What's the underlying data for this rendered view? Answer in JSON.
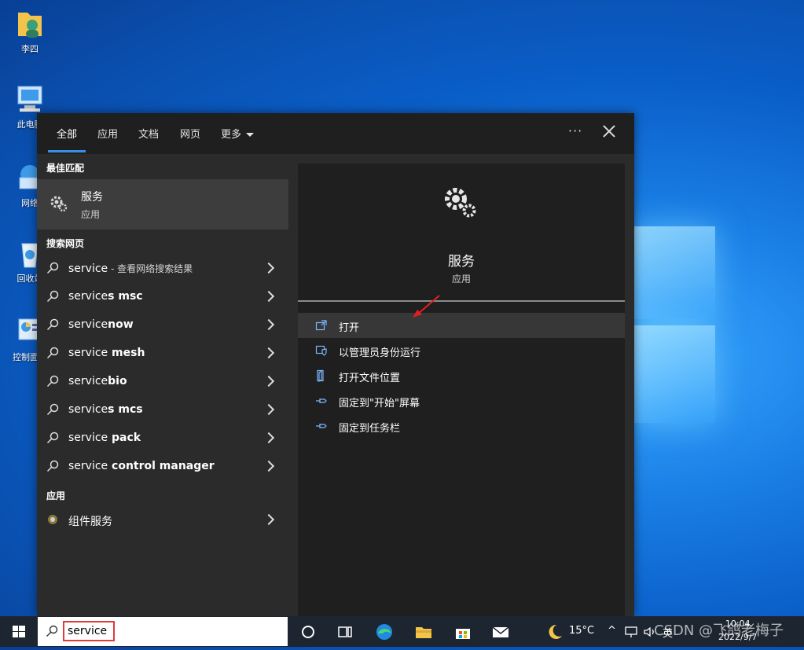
{
  "desktop": {
    "icons": [
      {
        "label": "李四",
        "icon": "user-folder-icon"
      },
      {
        "label": "此电脑",
        "icon": "computer-icon"
      },
      {
        "label": "网络",
        "icon": "network-icon"
      },
      {
        "label": "回收站",
        "icon": "recycle-bin-icon"
      },
      {
        "label": "控制面板",
        "icon": "control-panel-icon"
      }
    ]
  },
  "search_panel": {
    "tabs": [
      "全部",
      "应用",
      "文档",
      "网页",
      "更多"
    ],
    "active_tab": "全部",
    "ellipsis": "···",
    "best_match": {
      "section": "最佳匹配",
      "name": "服务",
      "type": "应用"
    },
    "web": {
      "section": "搜索网页",
      "items": [
        {
          "plain": "service",
          "bold": "",
          "hint": " - 查看网络搜索结果"
        },
        {
          "plain": "service",
          "bold": "s msc",
          "hint": ""
        },
        {
          "plain": "service",
          "bold": "now",
          "hint": ""
        },
        {
          "plain": "service",
          "bold": " mesh",
          "hint": ""
        },
        {
          "plain": "service",
          "bold": "bio",
          "hint": ""
        },
        {
          "plain": "service",
          "bold": "s mcs",
          "hint": ""
        },
        {
          "plain": "service",
          "bold": " pack",
          "hint": ""
        },
        {
          "plain": "service",
          "bold": " control manager",
          "hint": ""
        }
      ]
    },
    "apps": {
      "section": "应用",
      "items": [
        {
          "name": "组件服务",
          "icon": "component-services-icon"
        }
      ]
    },
    "preview": {
      "title": "服务",
      "type": "应用",
      "actions": [
        {
          "label": "打开",
          "icon": "open-icon"
        },
        {
          "label": "以管理员身份运行",
          "icon": "shield-icon"
        },
        {
          "label": "打开文件位置",
          "icon": "file-location-icon"
        },
        {
          "label": "固定到\"开始\"屏幕",
          "icon": "pin-icon"
        },
        {
          "label": "固定到任务栏",
          "icon": "pin-icon"
        }
      ]
    }
  },
  "taskbar": {
    "search_text": "service",
    "weather": "15°C",
    "ime": "英",
    "time": "10:04",
    "date": "2022/9/7"
  },
  "watermark": "CSDN @飞鸽老梅子",
  "colors": {
    "accent": "#3a8ee6",
    "highlight_box": "#e03a3a",
    "panel_bg": "#2b2b2b"
  }
}
